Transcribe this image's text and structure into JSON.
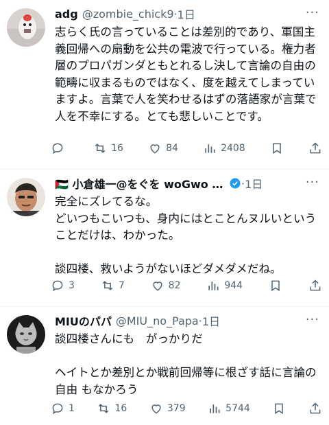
{
  "tweets": [
    {
      "name": "adg",
      "handle": "@zombie_chick9",
      "dot": "·",
      "time": "1日",
      "body": "志らく氏の言っていることは差別的であり、軍国主義回帰への扇動を公共の電波で行っている。権力者層のプロパガンダともとれるし決して言論の自由の範疇に収まるものではなく、度を越えてしまっていますよ。言葉で人を笑わせるはずの落語家が言葉で人を不幸にする。とても悲しいことです。",
      "replies": "",
      "retweets": "16",
      "likes": "84",
      "views": "2408"
    },
    {
      "name": "🇵🇸 小倉雄一@をぐを woGwo ちゃ…",
      "handle": "",
      "dot": "·",
      "time": "1日",
      "body": "完全にズレてるな。\nどいつもこいつも、身内にはとことんヌルいということだけは、わかった。\n\n談四楼、救いようがないほどダメダメだね。",
      "replies": "3",
      "retweets": "7",
      "likes": "82",
      "views": "944"
    },
    {
      "name": "MIUのパパ",
      "handle": "@MIU_no_Papa",
      "dot": "·",
      "time": "1日",
      "body": "談四楼さんにも　がっかりだ\n\nヘイトとか差別とか戦前回帰等に根ざす話に言論の自由 もなかろう",
      "replies": "1",
      "retweets": "16",
      "likes": "379",
      "views": "5744"
    }
  ],
  "more_label": "···",
  "icons": {
    "reply": "reply-icon",
    "retweet": "retweet-icon",
    "like": "heart-icon",
    "views": "views-chart-icon",
    "bookmark": "bookmark-icon",
    "share": "share-icon",
    "verified": "verified-badge-icon"
  },
  "colors": {
    "text": "#0f1419",
    "muted": "#536471",
    "verified": "#1d9bf0",
    "divider": "#eff3f4"
  }
}
